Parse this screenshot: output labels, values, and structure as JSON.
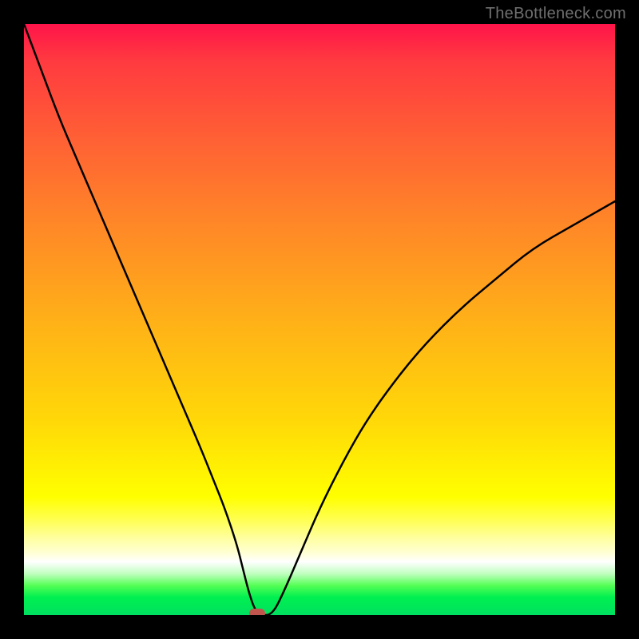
{
  "attribution": "TheBottleneck.com",
  "colors": {
    "frame": "#000000",
    "curve": "#000000",
    "marker": "#c0554d",
    "gradient_top": "#ff144a",
    "gradient_bottom": "#00e060"
  },
  "chart_data": {
    "type": "line",
    "title": "",
    "xlabel": "",
    "ylabel": "",
    "xlim": [
      0,
      100
    ],
    "ylim": [
      0,
      100
    ],
    "series": [
      {
        "name": "bottleneck-curve",
        "x": [
          0,
          3,
          6,
          9,
          12,
          15,
          18,
          21,
          24,
          27,
          30,
          32,
          34,
          36,
          37,
          38,
          39,
          40,
          42,
          44,
          47,
          50,
          54,
          58,
          63,
          68,
          74,
          80,
          86,
          93,
          100
        ],
        "values": [
          100,
          92,
          84,
          77,
          70,
          63,
          56,
          49,
          42,
          35,
          28,
          23,
          18,
          12,
          8,
          4,
          1,
          0,
          0,
          4,
          11,
          18,
          26,
          33,
          40,
          46,
          52,
          57,
          62,
          66,
          70
        ]
      }
    ],
    "marker": {
      "x": 39.5,
      "y": 0
    }
  }
}
